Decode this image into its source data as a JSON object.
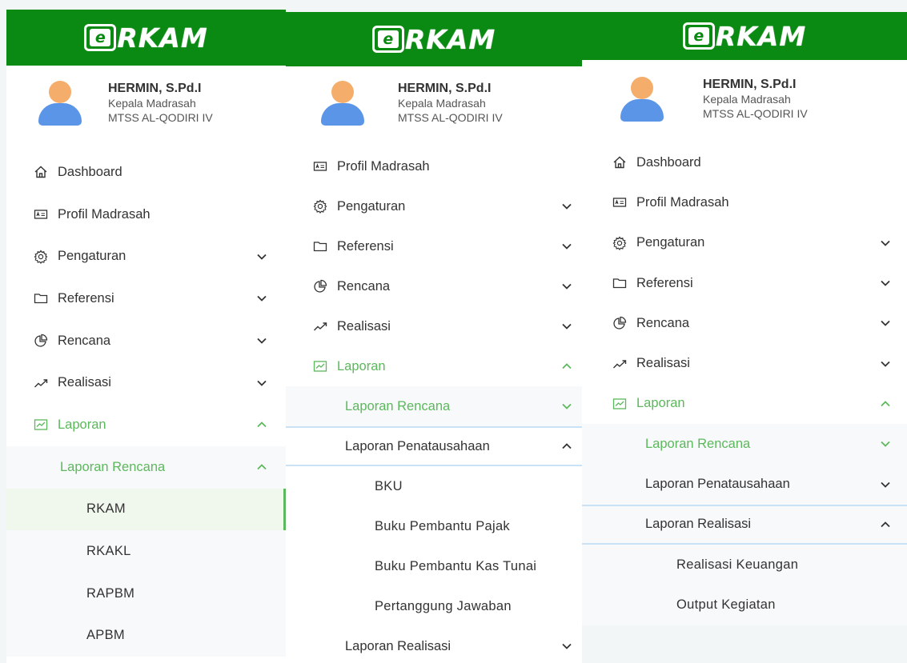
{
  "brand": {
    "logo_letter": "e",
    "logo_text": "RKAM",
    "color": "#0a8a12"
  },
  "user": {
    "name": "HERMIN, S.Pd.I",
    "role": "Kepala Madrasah",
    "school": "MTSS AL-QODIRI IV"
  },
  "colors": {
    "active": "#5cb85c",
    "accent_border": "#c9e2f5"
  },
  "panel1": {
    "menu": [
      {
        "label": "Dashboard",
        "icon": "home-icon"
      },
      {
        "label": "Profil Madrasah",
        "icon": "id-card-icon"
      },
      {
        "label": "Pengaturan",
        "icon": "gear-icon",
        "chevron": "down"
      },
      {
        "label": "Referensi",
        "icon": "folder-icon",
        "chevron": "down"
      },
      {
        "label": "Rencana",
        "icon": "pie-chart-icon",
        "chevron": "down"
      },
      {
        "label": "Realisasi",
        "icon": "trend-line-icon",
        "chevron": "down"
      },
      {
        "label": "Laporan",
        "icon": "line-chart-icon",
        "chevron": "up",
        "active": true
      }
    ],
    "sub": [
      {
        "label": "Laporan Rencana",
        "chevron": "up",
        "active": true
      }
    ],
    "sub2": [
      {
        "label": "RKAM",
        "selected": true
      },
      {
        "label": "RKAKL"
      },
      {
        "label": "RAPBM"
      },
      {
        "label": "APBM"
      }
    ]
  },
  "panel2": {
    "menu": [
      {
        "label": "Profil Madrasah",
        "icon": "id-card-icon"
      },
      {
        "label": "Pengaturan",
        "icon": "gear-icon",
        "chevron": "down"
      },
      {
        "label": "Referensi",
        "icon": "folder-icon",
        "chevron": "down"
      },
      {
        "label": "Rencana",
        "icon": "pie-chart-icon",
        "chevron": "down"
      },
      {
        "label": "Realisasi",
        "icon": "trend-line-icon",
        "chevron": "down"
      },
      {
        "label": "Laporan",
        "icon": "line-chart-icon",
        "chevron": "up",
        "active": true
      }
    ],
    "sub": [
      {
        "label": "Laporan Rencana",
        "chevron": "down",
        "active": true
      },
      {
        "label": "Laporan Penatausahaan",
        "chevron": "up"
      }
    ],
    "sub2": [
      {
        "label": "BKU"
      },
      {
        "label": "Buku Pembantu Pajak"
      },
      {
        "label": "Buku Pembantu Kas Tunai"
      },
      {
        "label": "Pertanggung Jawaban"
      }
    ],
    "sub_after": [
      {
        "label": "Laporan Realisasi",
        "chevron": "down"
      }
    ]
  },
  "panel3": {
    "menu": [
      {
        "label": "Dashboard",
        "icon": "home-icon"
      },
      {
        "label": "Profil Madrasah",
        "icon": "id-card-icon"
      },
      {
        "label": "Pengaturan",
        "icon": "gear-icon",
        "chevron": "down"
      },
      {
        "label": "Referensi",
        "icon": "folder-icon",
        "chevron": "down"
      },
      {
        "label": "Rencana",
        "icon": "pie-chart-icon",
        "chevron": "down"
      },
      {
        "label": "Realisasi",
        "icon": "trend-line-icon",
        "chevron": "down"
      },
      {
        "label": "Laporan",
        "icon": "line-chart-icon",
        "chevron": "up",
        "active": true
      }
    ],
    "sub": [
      {
        "label": "Laporan Rencana",
        "chevron": "down",
        "active": true
      },
      {
        "label": "Laporan Penatausahaan",
        "chevron": "down"
      },
      {
        "label": "Laporan Realisasi",
        "chevron": "up"
      }
    ],
    "sub2": [
      {
        "label": "Realisasi Keuangan"
      },
      {
        "label": "Output Kegiatan"
      }
    ]
  }
}
